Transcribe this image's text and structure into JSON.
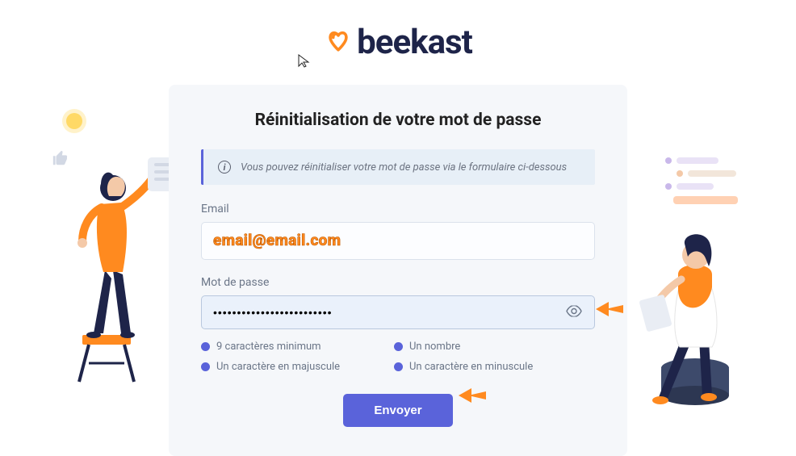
{
  "brand": {
    "name": "beekast"
  },
  "card": {
    "title": "Réinitialisation de votre mot de passe",
    "info_text": "Vous pouvez réinitialiser votre mot de passe via le formulaire ci-dessous",
    "email_label": "Email",
    "email_value": "email@email.com",
    "password_label": "Mot de passe",
    "password_value": "•••••••••••••••••••••••••",
    "rules": [
      "9 caractères minimum",
      "Un nombre",
      "Un caractère en majuscule",
      "Un caractère en minuscule"
    ],
    "submit_label": "Envoyer"
  },
  "colors": {
    "accent": "#5a63da",
    "orange": "#ff8a1f",
    "dark": "#1e2449"
  }
}
